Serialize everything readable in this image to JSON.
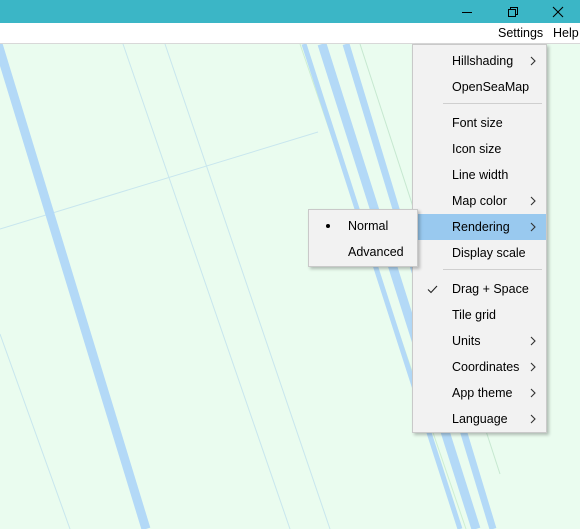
{
  "window": {
    "controls": [
      "minimize-icon",
      "restore-icon",
      "close-icon"
    ],
    "titlebar_color": "#3bb6c6"
  },
  "menubar": {
    "items": [
      {
        "label": "Settings"
      },
      {
        "label": "Help"
      }
    ]
  },
  "settings_menu": {
    "items": [
      {
        "label": "Hillshading",
        "submenu": true
      },
      {
        "label": "OpenSeaMap",
        "submenu": false
      },
      {
        "label": "Font size",
        "submenu": false
      },
      {
        "label": "Icon size",
        "submenu": false
      },
      {
        "label": "Line width",
        "submenu": false
      },
      {
        "label": "Map color",
        "submenu": true
      },
      {
        "label": "Rendering",
        "submenu": true,
        "highlighted": true
      },
      {
        "label": "Display scale",
        "submenu": false
      },
      {
        "label": "Drag + Space",
        "submenu": false,
        "checked": true
      },
      {
        "label": "Tile grid",
        "submenu": false
      },
      {
        "label": "Units",
        "submenu": true
      },
      {
        "label": "Coordinates",
        "submenu": true
      },
      {
        "label": "App theme",
        "submenu": true
      },
      {
        "label": "Language",
        "submenu": true
      }
    ],
    "highlight_color": "#99c9ef"
  },
  "rendering_submenu": {
    "items": [
      {
        "label": "Normal",
        "selected": true
      },
      {
        "label": "Advanced",
        "selected": false
      }
    ]
  },
  "map": {
    "background": "#eafcef",
    "water_color": "#b3d9f7"
  }
}
